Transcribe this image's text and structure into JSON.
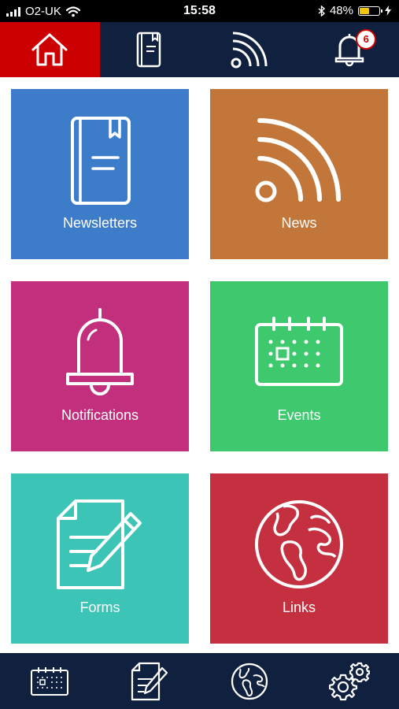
{
  "status_bar": {
    "carrier": "O2-UK",
    "time": "15:58",
    "battery_percent": "48%",
    "battery_level": 0.48
  },
  "top_nav": {
    "tabs": [
      {
        "name": "home",
        "icon": "home-icon",
        "active": true
      },
      {
        "name": "newsletters",
        "icon": "book-icon",
        "active": false
      },
      {
        "name": "news",
        "icon": "rss-icon",
        "active": false
      },
      {
        "name": "notifications",
        "icon": "bell-icon",
        "active": false
      }
    ],
    "notification_count": "6"
  },
  "tiles": [
    {
      "label": "Newsletters",
      "icon": "book-icon",
      "color": "#3d7cc9"
    },
    {
      "label": "News",
      "icon": "rss-icon",
      "color": "#c37639"
    },
    {
      "label": "Notifications",
      "icon": "bell-icon",
      "color": "#c22f7d"
    },
    {
      "label": "Events",
      "icon": "calendar-icon",
      "color": "#3fc96f"
    },
    {
      "label": "Forms",
      "icon": "form-pen-icon",
      "color": "#3cc4b7"
    },
    {
      "label": "Links",
      "icon": "globe-icon",
      "color": "#c4303f"
    }
  ],
  "bottom_nav": {
    "tabs": [
      {
        "name": "events",
        "icon": "calendar-icon"
      },
      {
        "name": "forms",
        "icon": "form-pen-icon"
      },
      {
        "name": "links",
        "icon": "globe-icon"
      },
      {
        "name": "settings",
        "icon": "gears-icon"
      }
    ]
  },
  "colors": {
    "nav_background": "#10203f",
    "active_tab": "#cc0000"
  }
}
